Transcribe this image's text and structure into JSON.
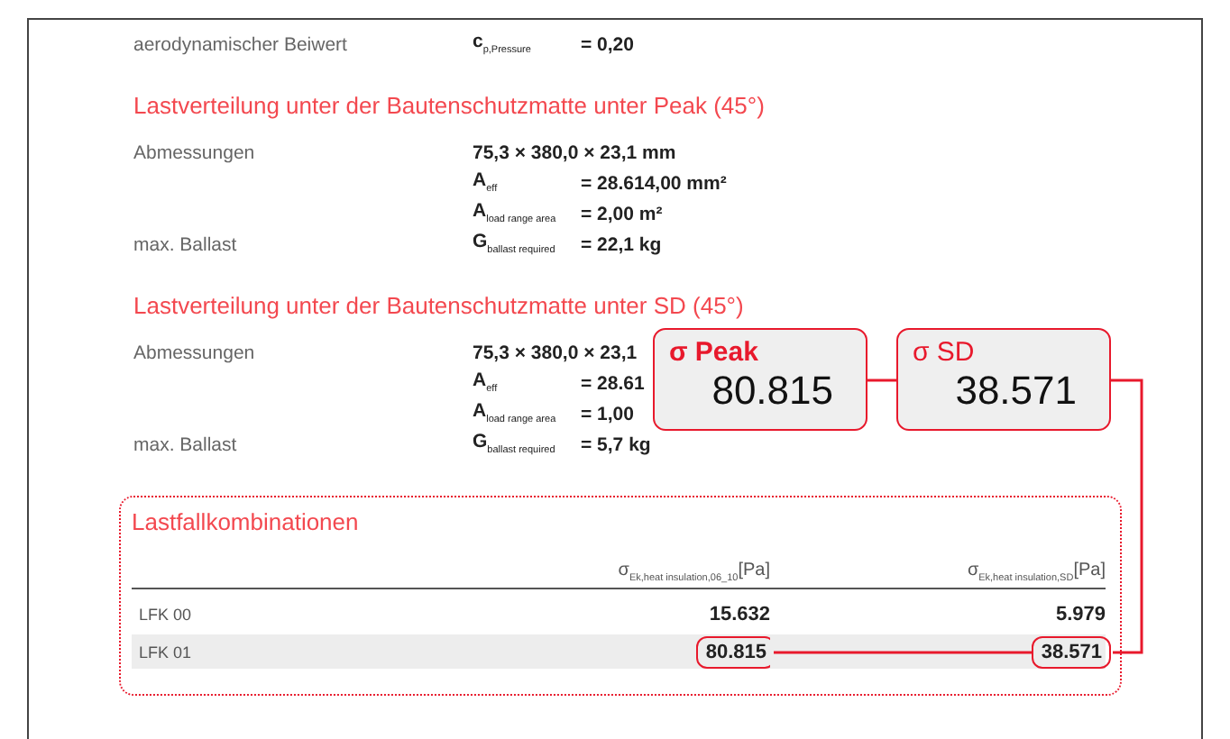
{
  "intro_rows": [
    {
      "label": "aerodynamischer Beiwert",
      "symbol": "c$_{p,Pressure}$",
      "value": "= 0,20"
    }
  ],
  "sections": [
    {
      "title": "Lastverteilung unter der Bautenschutzmatte unter Peak (45°)",
      "rows": [
        {
          "label": "Abmessungen",
          "value": "75,3 × 380,0 × 23,1 mm"
        },
        {
          "symbol": "A$_{eff}$",
          "value": "= 28.614,00 mm²"
        },
        {
          "symbol": "A$_{load range area}$",
          "value": "= 2,00 m²"
        },
        {
          "label": "max. Ballast",
          "symbol": "G$_{ballast required}$",
          "value": "= 22,1 kg"
        }
      ]
    },
    {
      "title": "Lastverteilung unter der Bautenschutzmatte unter SD (45°)",
      "rows": [
        {
          "label": "Abmessungen",
          "value": "75,3 × 380,0 × 23,1"
        },
        {
          "symbol": "A$_{eff}$",
          "value": "= 28.61"
        },
        {
          "symbol": "A$_{load range area}$",
          "value": "= 1,00"
        },
        {
          "label": "max. Ballast",
          "symbol": "G$_{ballast required}$",
          "value": "= 5,7 kg"
        }
      ]
    }
  ],
  "callouts": [
    {
      "title": "σ Peak",
      "bold": true,
      "value": "80.815"
    },
    {
      "title": "σ SD",
      "bold": false,
      "value": "38.571"
    }
  ],
  "table": {
    "title": "Lastfallkombinationen",
    "columns": [
      "σ$_{Ek,heat insulation,06_10}$[Pa]",
      "σ$_{Ek,heat insulation,SD}$[Pa]"
    ],
    "rows": [
      {
        "label": "LFK 00",
        "values": [
          "15.632",
          "5.979"
        ],
        "highlighted": false
      },
      {
        "label": "LFK 01",
        "values": [
          "80.815",
          "38.571"
        ],
        "highlighted": true
      }
    ]
  }
}
